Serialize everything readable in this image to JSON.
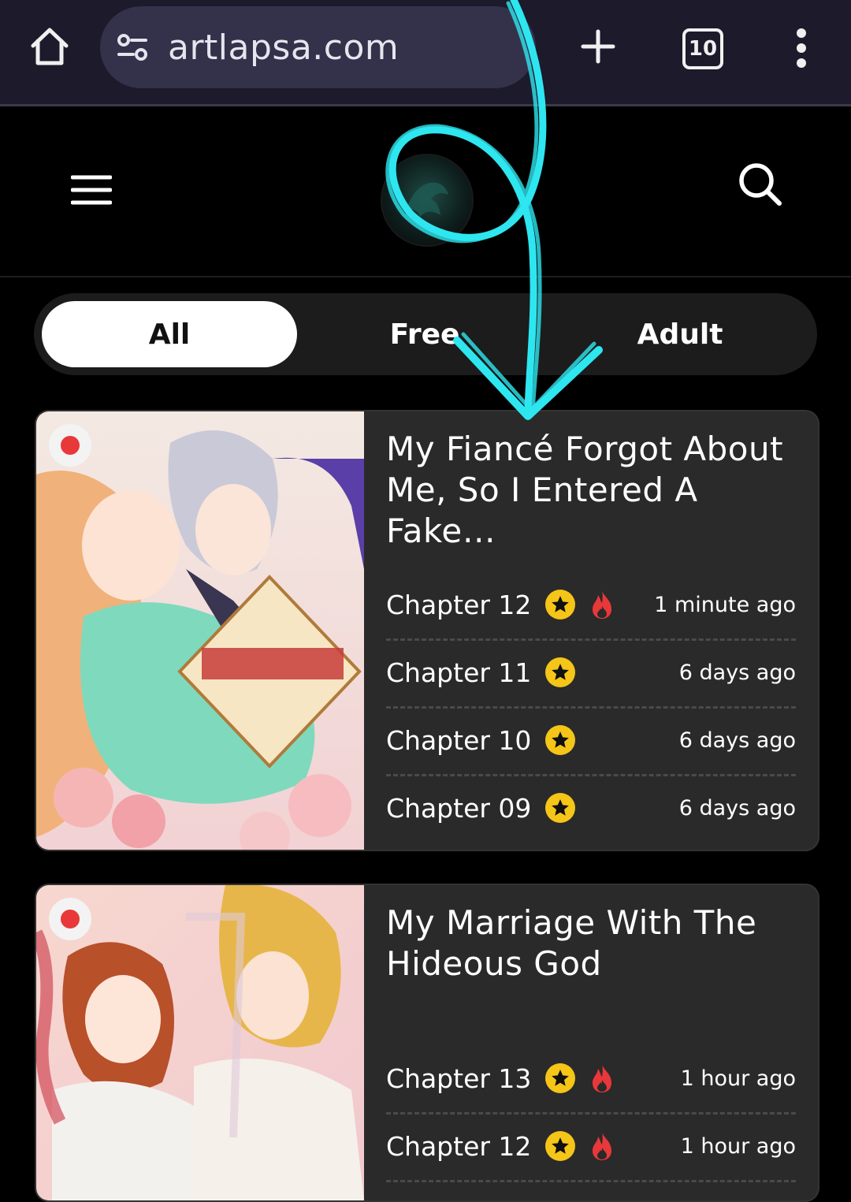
{
  "browser": {
    "url": "artlapsa.com",
    "tab_count": "10"
  },
  "filters": [
    "All",
    "Free",
    "Adult"
  ],
  "active_filter": "All",
  "series": [
    {
      "title": "My Fiancé Forgot About Me, So I Entered A Fake…",
      "chapters": [
        {
          "label": "Chapter 12",
          "time": "1 minute ago",
          "hot": true
        },
        {
          "label": "Chapter 11",
          "time": "6 days ago",
          "hot": false
        },
        {
          "label": "Chapter 10",
          "time": "6 days ago",
          "hot": false
        },
        {
          "label": "Chapter 09",
          "time": "6 days ago",
          "hot": false
        }
      ]
    },
    {
      "title": "My Marriage With The Hideous God",
      "chapters": [
        {
          "label": "Chapter 13",
          "time": "1 hour ago",
          "hot": true
        },
        {
          "label": "Chapter 12",
          "time": "1 hour ago",
          "hot": true
        }
      ]
    }
  ],
  "colors": {
    "browser_bar": "#1c1a2b",
    "url_pill": "#34324a",
    "card_bg": "#2a2a2a",
    "star": "#f5c518",
    "fire": "#e8383a",
    "annotation_arrow": "#2ee6f0"
  },
  "icons": {
    "home": "home-icon",
    "site_settings": "tune-icon",
    "new_tab": "plus-icon",
    "menu": "kebab-menu-icon",
    "hamburger": "hamburger-menu-icon",
    "search": "search-icon",
    "star": "star-icon",
    "fire": "fire-icon"
  }
}
